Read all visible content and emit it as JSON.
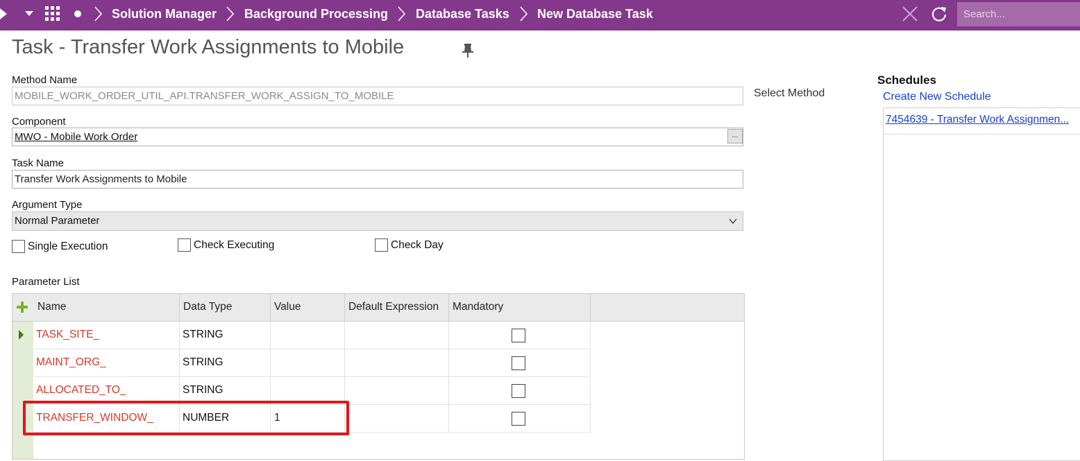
{
  "topbar": {
    "breadcrumbs": [
      "Solution Manager",
      "Background Processing",
      "Database Tasks",
      "New Database Task"
    ],
    "search_placeholder": "Search..."
  },
  "page": {
    "title": "Task - Transfer Work Assignments to Mobile"
  },
  "form": {
    "method_name_label": "Method Name",
    "method_name_value": "MOBILE_WORK_ORDER_UTIL_API.TRANSFER_WORK_ASSIGN_TO_MOBILE",
    "select_method_label": "Select Method",
    "component_label": "Component",
    "component_value": "MWO - Mobile Work Order",
    "component_lookup_label": "...",
    "task_name_label": "Task Name",
    "task_name_value": "Transfer Work Assignments to Mobile",
    "argument_type_label": "Argument Type",
    "argument_type_value": "Normal Parameter",
    "checkboxes": [
      {
        "label": "Single Execution",
        "checked": false
      },
      {
        "label": "Check Executing",
        "checked": false
      },
      {
        "label": "Check Day",
        "checked": false
      }
    ]
  },
  "parameter_list": {
    "label": "Parameter List",
    "columns": [
      "Name",
      "Data Type",
      "Value",
      "Default Expression",
      "Mandatory"
    ],
    "rows": [
      {
        "name": "TASK_SITE_",
        "data_type": "STRING",
        "value": "",
        "default_expression": "",
        "mandatory": false
      },
      {
        "name": "MAINT_ORG_",
        "data_type": "STRING",
        "value": "",
        "default_expression": "",
        "mandatory": false
      },
      {
        "name": "ALLOCATED_TO_",
        "data_type": "STRING",
        "value": "",
        "default_expression": "",
        "mandatory": false
      },
      {
        "name": "TRANSFER_WINDOW_",
        "data_type": "NUMBER",
        "value": "1",
        "default_expression": "",
        "mandatory": false
      }
    ]
  },
  "schedules": {
    "title": "Schedules",
    "create_label": "Create New Schedule",
    "items": [
      "7454639 - Transfer Work Assignmen..."
    ]
  },
  "colors": {
    "topbar": "#84388c",
    "param_name": "#d23a2a",
    "link": "#1a3fcf",
    "highlight": "#e4151b"
  }
}
